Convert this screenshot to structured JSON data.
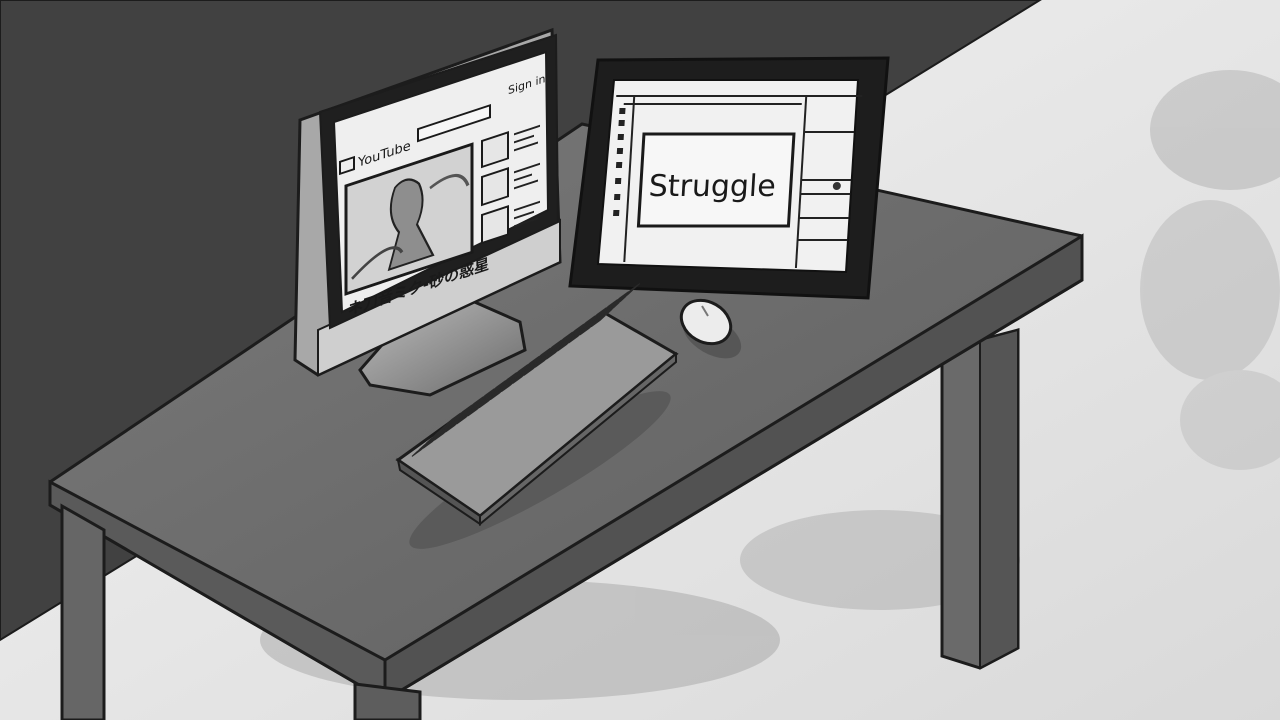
{
  "monitor_left": {
    "brand_label": "YouTube",
    "sign_in": "Sign in",
    "video_title": "ネ刀音ミク-砂の惑星"
  },
  "monitor_right": {
    "canvas_text": "Struggle"
  },
  "colors": {
    "wall": "#414141",
    "floor": "#e8e8e8",
    "desk_top": "#6c6c6c",
    "desk_edge": "#5a5a5a",
    "outline": "#1c1c1c",
    "screen_white": "#f1f1f1"
  }
}
